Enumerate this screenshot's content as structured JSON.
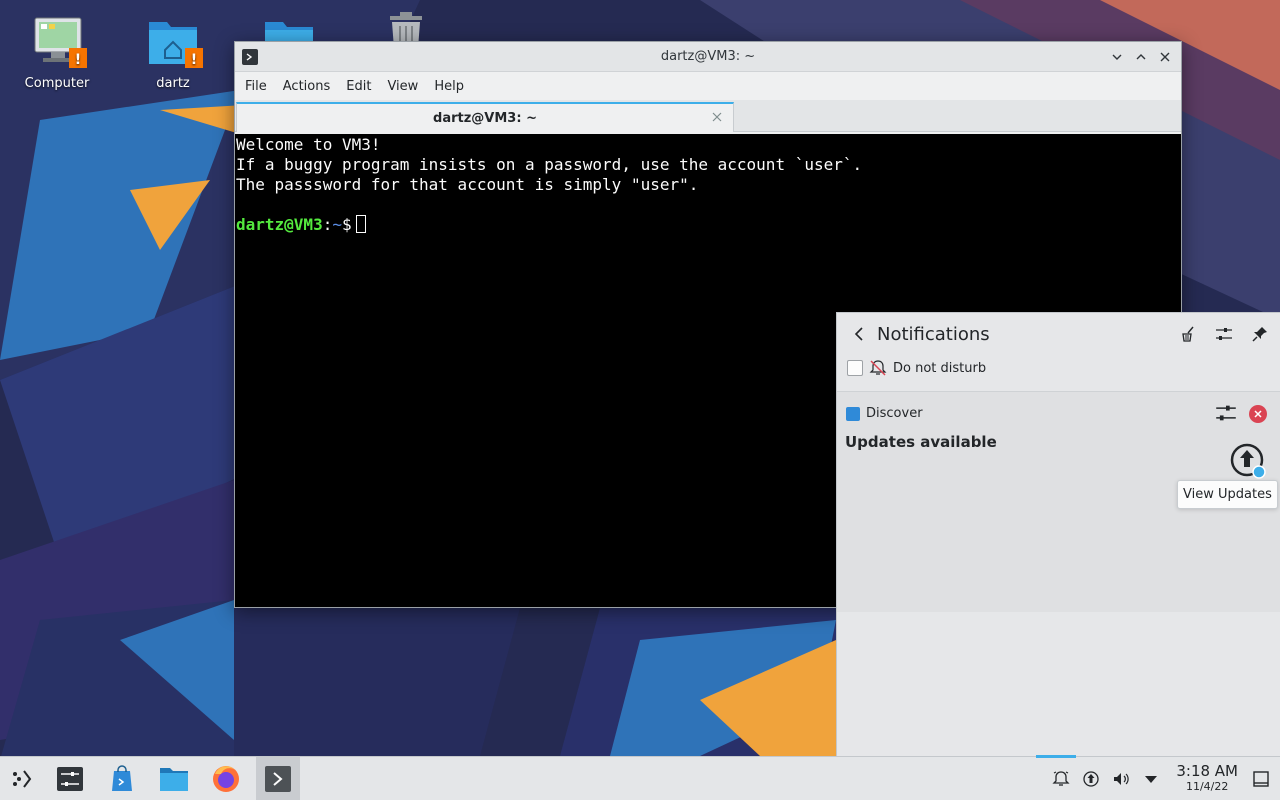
{
  "desktop": {
    "icons": [
      {
        "label": "Computer",
        "icon": "computer-icon"
      },
      {
        "label": "dartz",
        "icon": "home-folder-icon"
      },
      {
        "label": "",
        "icon": "folder-icon"
      },
      {
        "label": "",
        "icon": "trash-icon"
      }
    ]
  },
  "window": {
    "title": "dartz@VM3: ~",
    "menu": [
      "File",
      "Actions",
      "Edit",
      "View",
      "Help"
    ],
    "tab_title": "dartz@VM3: ~"
  },
  "terminal": {
    "lines": [
      "Welcome to VM3!",
      "If a buggy program insists on a password, use the account `user`.",
      "The passsword for that account is simply \"user\".",
      ""
    ],
    "prompt_user": "dartz@VM3",
    "prompt_sep": ":",
    "prompt_path": "~",
    "prompt_symbol": "$"
  },
  "notifications": {
    "title": "Notifications",
    "dnd_label": "Do not disturb",
    "dnd_checked": false,
    "items": [
      {
        "app": "Discover",
        "summary": "Updates available",
        "action_tooltip": "View Updates"
      }
    ]
  },
  "taskbar": {
    "apps": [
      "launcher-icon",
      "system-settings-icon",
      "discover-icon",
      "dolphin-icon",
      "firefox-icon",
      "konsole-icon"
    ],
    "active_app": "konsole-icon",
    "clock_time": "3:18 AM",
    "clock_date": "11/4/22"
  },
  "colors": {
    "accent": "#3daee9",
    "prompt_user": "#54e93e",
    "prompt_path": "#5c8fe8",
    "close_red": "#da4453"
  }
}
